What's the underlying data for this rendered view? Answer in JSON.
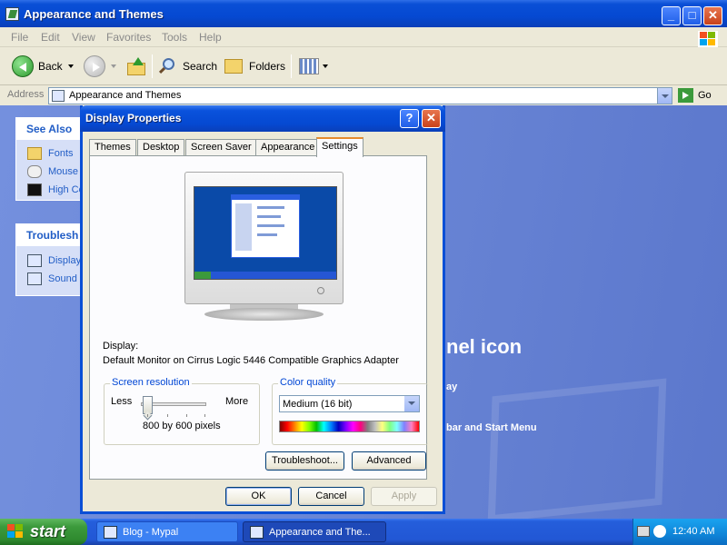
{
  "explorer": {
    "title": "Appearance and Themes",
    "menu": [
      "File",
      "Edit",
      "View",
      "Favorites",
      "Tools",
      "Help"
    ],
    "toolbar": {
      "back": "Back",
      "search": "Search",
      "folders": "Folders"
    },
    "address": {
      "label": "Address",
      "value": "Appearance and Themes",
      "go": "Go"
    },
    "see_also": {
      "title": "See Also",
      "items": [
        "Fonts",
        "Mouse",
        "High Co"
      ]
    },
    "troubleshooters": {
      "title": "Troublesh",
      "items": [
        "Display",
        "Sound"
      ]
    },
    "background_heading": "nel icon",
    "background_links": [
      "ay",
      "bar and Start Menu"
    ]
  },
  "dialog": {
    "title": "Display Properties",
    "tabs": [
      "Themes",
      "Desktop",
      "Screen Saver",
      "Appearance",
      "Settings"
    ],
    "active_tab": "Settings",
    "display_label": "Display:",
    "display_value": "Default Monitor on Cirrus Logic 5446 Compatible Graphics Adapter",
    "resolution": {
      "group_label": "Screen resolution",
      "less": "Less",
      "more": "More",
      "value": "800 by 600 pixels",
      "slider_level": 0
    },
    "color_quality": {
      "group_label": "Color quality",
      "selected": "Medium (16 bit)"
    },
    "buttons": {
      "troubleshoot": "Troubleshoot...",
      "advanced": "Advanced",
      "ok": "OK",
      "cancel": "Cancel",
      "apply": "Apply"
    }
  },
  "taskbar": {
    "start": "start",
    "items": [
      "Blog - Mypal",
      "Appearance and The..."
    ],
    "clock": "12:40 AM"
  },
  "colors": {
    "xp_blue": "#0549d2",
    "start_green": "#3c9a3c",
    "group_label": "#0046d5"
  }
}
